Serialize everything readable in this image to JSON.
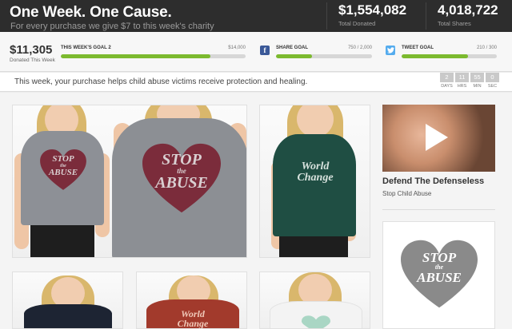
{
  "banner": {
    "title": "One Week. One Cause.",
    "subtitle": "For every purchase we give $7 to this week's charity",
    "total_donated": {
      "value": "$1,554,082",
      "label": "Total Donated"
    },
    "total_shares": {
      "value": "4,018,722",
      "label": "Total Shares"
    }
  },
  "progress": {
    "donated_week": {
      "value": "$11,305",
      "label": "Donated This Week"
    },
    "goals": [
      {
        "name": "This Week's Goal 2",
        "target": "$14,000",
        "progress": 0.81
      },
      {
        "name": "Share Goal",
        "target": "750 / 2,000",
        "progress": 0.375
      },
      {
        "name": "Tweet Goal",
        "target": "210 / 300",
        "progress": 0.7
      }
    ],
    "icons": {
      "share": "facebook-icon",
      "tweet": "twitter-icon"
    }
  },
  "message": {
    "text": "This week, your purchase helps child abuse victims receive protection and healing.",
    "countdown": [
      {
        "value": "2",
        "label": "DAYS"
      },
      {
        "value": "11",
        "label": "HRS"
      },
      {
        "value": "55",
        "label": "MIN"
      },
      {
        "value": "0",
        "label": "SEC"
      }
    ]
  },
  "products": {
    "stop_abuse_print": {
      "line1": "STOP",
      "line2": "the",
      "line3": "ABUSE"
    },
    "world_change_print": {
      "line1": "World",
      "line2": "Change"
    }
  },
  "sidebar": {
    "video_title": "Defend The Defenseless",
    "video_subtitle": "Stop Child Abuse",
    "logo": {
      "line1": "STOP",
      "line2": "the",
      "line3": "ABUSE"
    }
  },
  "colors": {
    "banner_bg": "#2d2d2d",
    "progress_fill": "#7cba2f",
    "heart_maroon": "#7b2c3b",
    "facebook_blue": "#3b5998",
    "twitter_blue": "#55acee"
  }
}
